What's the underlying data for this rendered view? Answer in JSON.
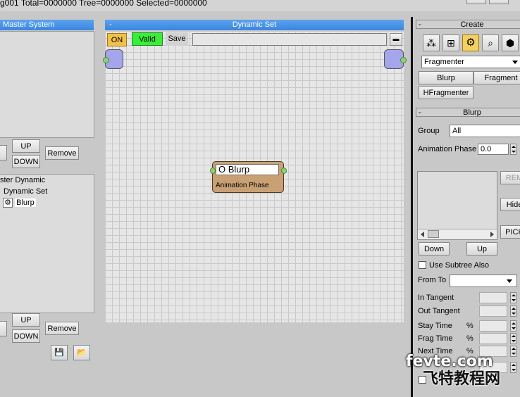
{
  "status_bar": {
    "text": "g001  Total=0000000  Tree=0000000  Selected=0000000"
  },
  "master_system": {
    "title": "Master System",
    "up_label": "UP",
    "down_label": "DOWN",
    "remove_label": "Remove"
  },
  "tree": {
    "items": [
      "ster Dynamic",
      "Dynamic Set",
      "Blurp"
    ],
    "up_label": "UP",
    "down_label": "DOWN",
    "remove_label": "Remove"
  },
  "dynamic_set": {
    "title": "Dynamic Set",
    "collapse": "-",
    "on_label": "ON",
    "valid_label": "Valid",
    "save_label": "Save",
    "minimize": "▬",
    "node": {
      "title": "O Blurp",
      "subtitle": "Animation Phase"
    }
  },
  "create_panel": {
    "title": "Create",
    "collapse": "-",
    "icons": [
      "particles-icon",
      "grid-add-icon",
      "gear-icon",
      "magnifier-icon",
      "cube-icon"
    ],
    "dropdown": "Fragmenter",
    "buttons": [
      "Blurp",
      "Fragment",
      "HFragmenter"
    ]
  },
  "blurp_panel": {
    "title": "Blurp",
    "collapse": "-",
    "group_label": "Group",
    "group_value": "All",
    "anim_phase_label": "Animation Phase",
    "anim_phase_value": "0.0",
    "rem_label": "REM",
    "hide_label": "Hide",
    "pick_label": "PICK",
    "down_label": "Down",
    "up_label": "Up",
    "use_subtree_label": "Use Subtree Also",
    "from_to_label": "From To",
    "in_tangent_label": "In Tangent",
    "out_tangent_label": "Out Tangent",
    "stay_time_label": "Stay Time",
    "frag_time_label": "Frag Time",
    "next_time_label": "Next Time",
    "percent": "%"
  },
  "watermark": {
    "text1": "fevte.com",
    "text2": "飞特教程网"
  }
}
